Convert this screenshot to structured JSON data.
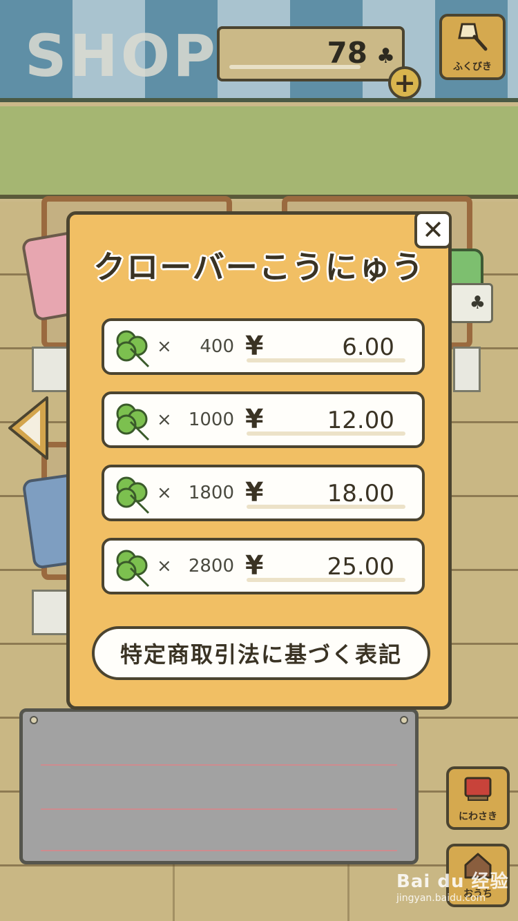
{
  "header": {
    "shop_title": "SHOP",
    "currency_amount": "78",
    "currency_icon": "clover-icon",
    "plus_label": "+",
    "lottery_label": "ふくびき"
  },
  "modal": {
    "title": "クローバーこうにゅう",
    "close_label": "✕",
    "times_symbol": "×",
    "currency_symbol": "¥",
    "packs": [
      {
        "quantity": "400",
        "price": "6.00"
      },
      {
        "quantity": "1000",
        "price": "12.00"
      },
      {
        "quantity": "1800",
        "price": "18.00"
      },
      {
        "quantity": "2800",
        "price": "25.00"
      }
    ],
    "legal_button": "特定商取引法に基づく表記"
  },
  "side_buttons": {
    "garden_label": "にわさき",
    "home_label": "おうち"
  },
  "watermark": {
    "main": "Bai du 经验",
    "sub": "jingyan.baidu.com"
  },
  "colors": {
    "modal_bg": "#f1bf64",
    "outline": "#4b4430",
    "clover_green": "#7cc04f",
    "button_gold": "#d5a94f"
  }
}
